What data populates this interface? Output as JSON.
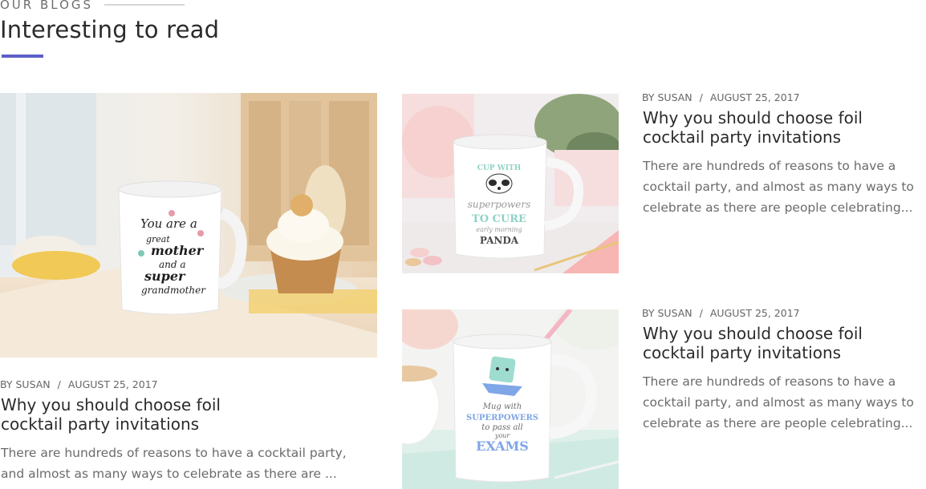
{
  "section": {
    "eyebrow": "OUR BLOGS",
    "title": "Interesting to read",
    "accent_color": "#5b5fc7"
  },
  "posts": [
    {
      "author": "BY SUSAN",
      "separator": "/",
      "date": "AUGUST 25, 2017",
      "title": "Why you should choose foil cocktail party invitations",
      "excerpt": "There are hundreds of reasons to have a cocktail party, and almost as many ways to celebrate as there are ...",
      "image": {
        "icon": "mug-with-cupcake-photo",
        "mug_text": [
          "You are a",
          "great",
          "mother",
          "and a",
          "super",
          "grandmother"
        ]
      }
    },
    {
      "author": "BY SUSAN",
      "separator": "/",
      "date": "AUGUST 25, 2017",
      "title": "Why you should choose foil cocktail party invitations",
      "excerpt": "There are hundreds of reasons to have a cocktail party, and almost as many ways to celebrate as there are people celebrating...",
      "image": {
        "icon": "panda-mug-photo",
        "mug_text": [
          "CUP WITH",
          "superpowers",
          "TO CURE",
          "early morning",
          "PANDA"
        ]
      }
    },
    {
      "author": "BY SUSAN",
      "separator": "/",
      "date": "AUGUST 25, 2017",
      "title": "Why you should choose foil cocktail party invitations",
      "excerpt": "There are hundreds of reasons to have a cocktail party, and almost as many ways to celebrate as there are people celebrating...",
      "image": {
        "icon": "exams-mug-photo",
        "mug_text": [
          "Mug with",
          "SUPERPOWERS",
          "to pass all",
          "your",
          "EXAMS"
        ]
      }
    }
  ]
}
